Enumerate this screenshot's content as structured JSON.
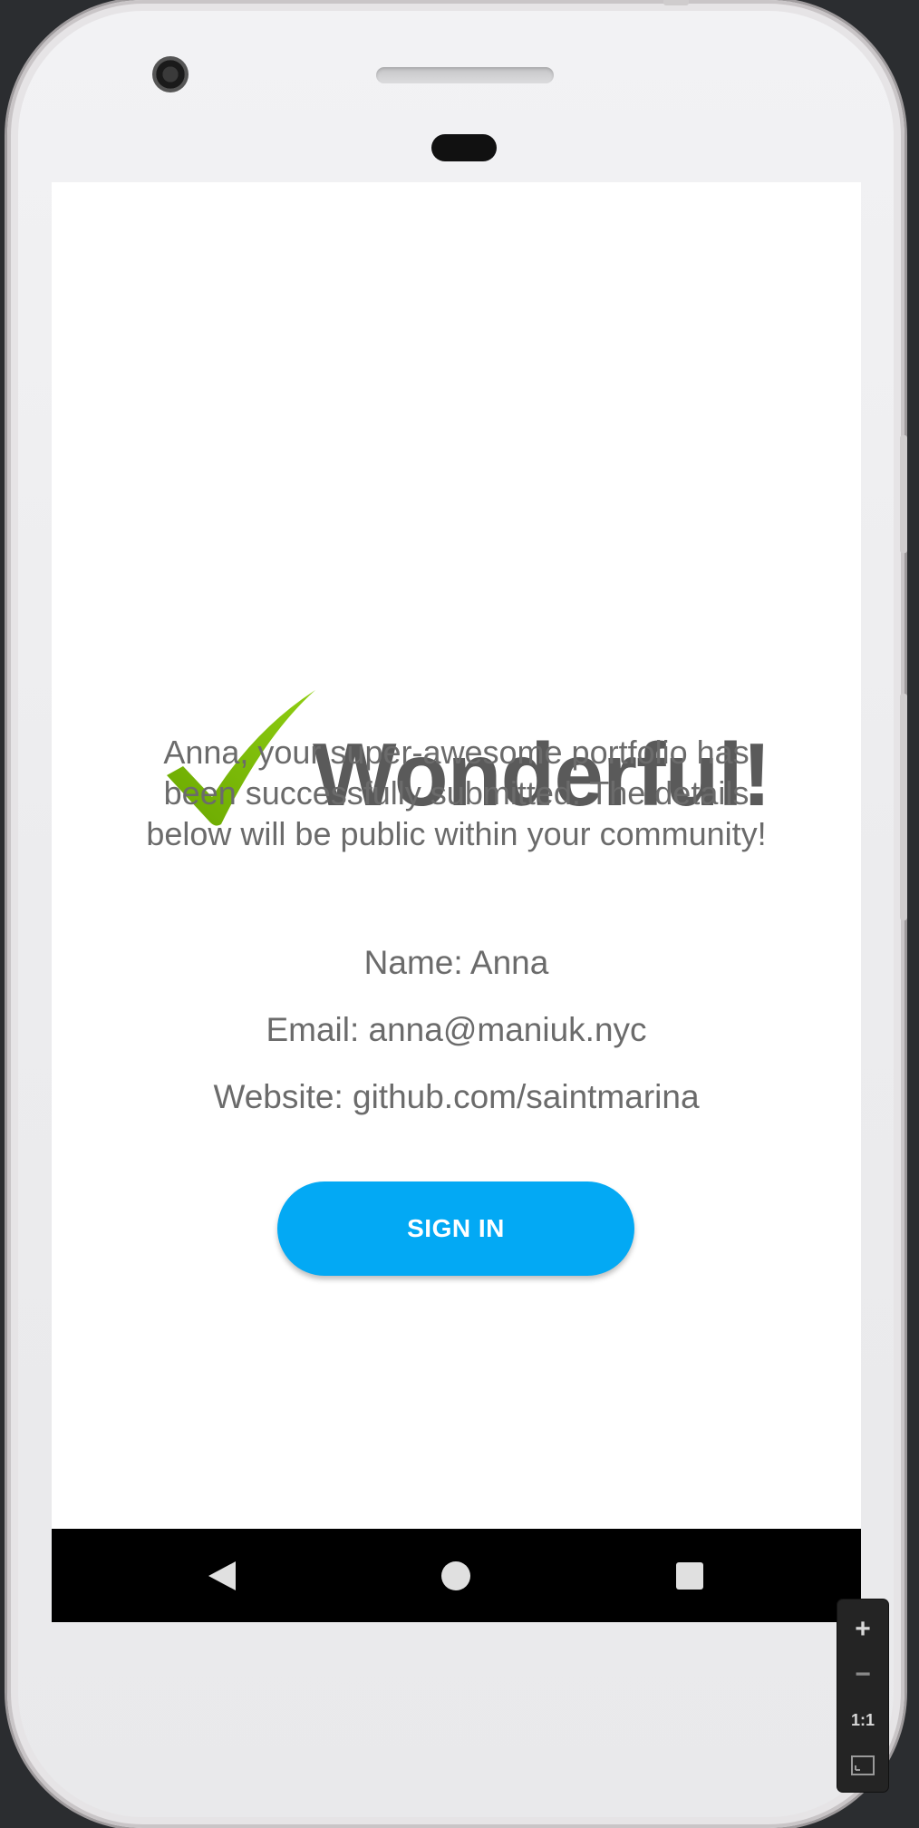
{
  "screen": {
    "headline": "Wonderful!",
    "message": "Anna, your super-awesome portfolio has been successfully submitted. The details below will be public within your community!",
    "details": {
      "name": "Name: Anna",
      "email": "Email: anna@maniuk.nyc",
      "website": "Website: github.com/saintmarina"
    },
    "button_label": "SIGN IN"
  },
  "navigation": {
    "back_icon": "back-triangle-icon",
    "home_icon": "home-circle-icon",
    "recents_icon": "recents-square-icon"
  },
  "zoom_controls": {
    "zoom_in": "+",
    "zoom_out": "−",
    "actual_size": "1:1",
    "fit_icon": "fit-screen-icon"
  },
  "colors": {
    "accent": "#03a9f4",
    "check": "#7cbb00",
    "headline": "#5a5a5a",
    "body_text": "#6b6b6b"
  }
}
